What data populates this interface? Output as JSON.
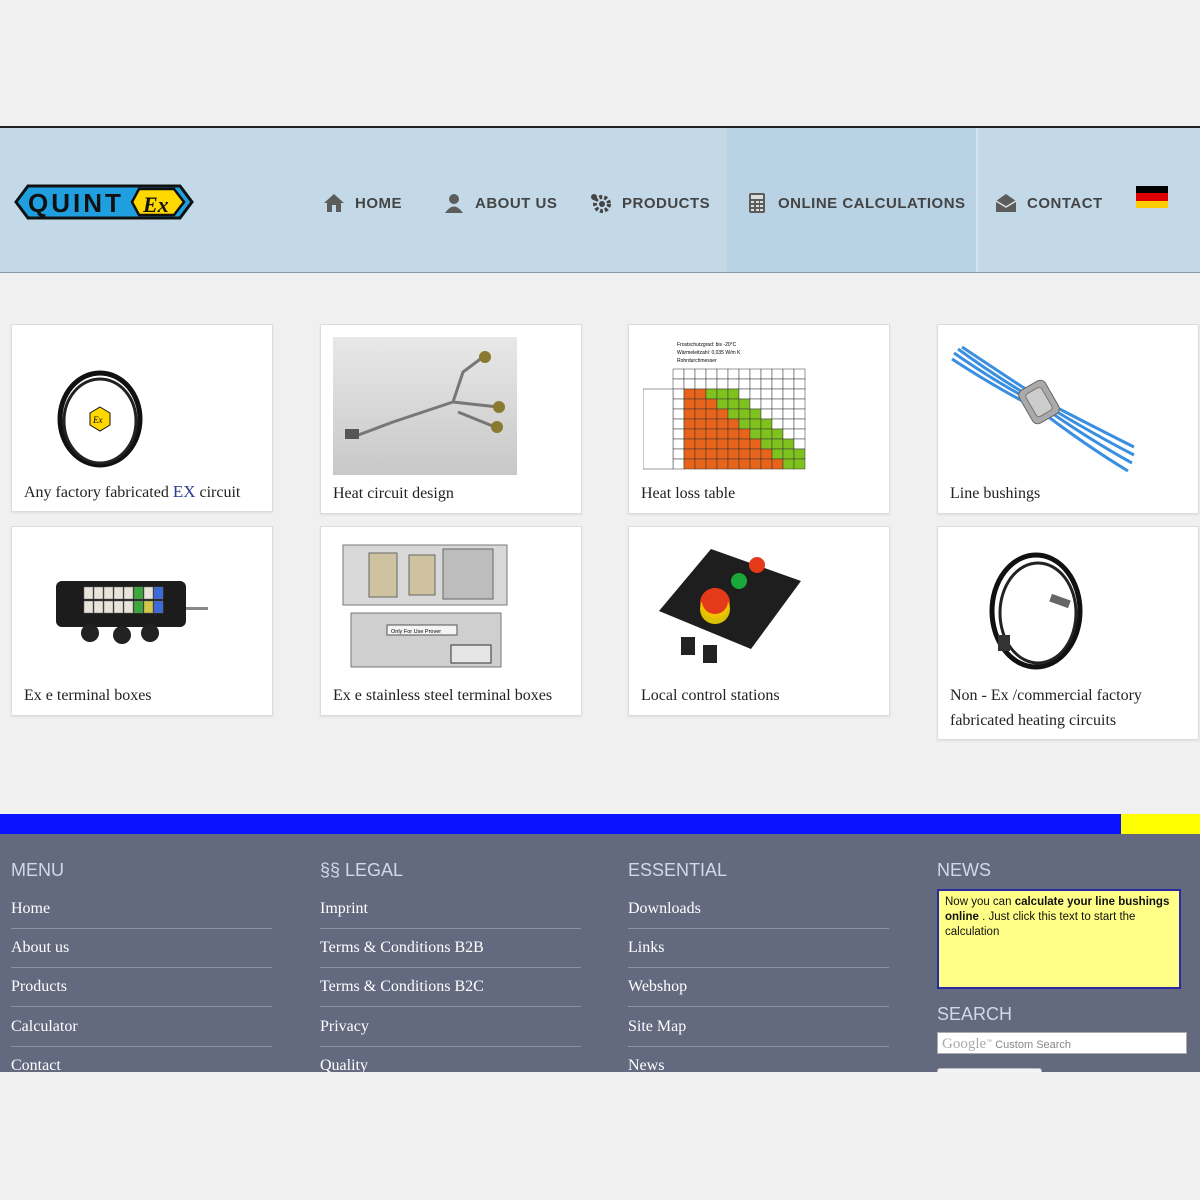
{
  "header": {
    "logo_text_1": "QUINT",
    "logo_text_2": "Ex",
    "nav": [
      {
        "label": "HOME",
        "icon": "house-icon"
      },
      {
        "label": "ABOUT US",
        "icon": "person-icon"
      },
      {
        "label": "PRODUCTS",
        "icon": "gears-icon"
      },
      {
        "label": "ONLINE CALCULATIONS",
        "icon": "calculator-icon"
      },
      {
        "label": "CONTACT",
        "icon": "envelope-icon"
      }
    ],
    "language_flag": "german-flag-icon"
  },
  "products": [
    {
      "caption_pre": "Any factory fabricated ",
      "caption_em": "EX",
      "caption_post": " circuit"
    },
    {
      "caption": "Heat circuit design"
    },
    {
      "caption": "Heat loss table"
    },
    {
      "caption": "Line bushings"
    },
    {
      "caption": "Ex e terminal boxes"
    },
    {
      "caption": "Ex e stainless steel terminal boxes"
    },
    {
      "caption": "Local control stations"
    },
    {
      "caption_line1": "Non - Ex /commercial factory",
      "caption_line2": "fabricated heating circuits"
    }
  ],
  "heat_loss_table": {
    "line1": "Frostschutzgrad: bis -20°C",
    "line2": "Wärmeleitzahl: 0,035 W/m K",
    "line3": "Rohrdurchmesser"
  },
  "terminal_box_label": "Only For Use Prover",
  "footer": {
    "menu": {
      "title": "MENU",
      "links": [
        "Home",
        "About us",
        "Products",
        "Calculator",
        "Contact"
      ]
    },
    "legal": {
      "title": "§§ LEGAL",
      "links": [
        "Imprint",
        "Terms & Conditions B2B",
        "Terms & Conditions B2C",
        "Privacy",
        "Quality"
      ]
    },
    "essential": {
      "title": "ESSENTIAL",
      "links": [
        "Downloads",
        "Links",
        "Webshop",
        "Site Map",
        "News"
      ]
    },
    "news": {
      "title": "NEWS",
      "text_pre": "Now you can ",
      "text_bold": "calculate your line bushings online",
      "text_post": " . Just click this text to start the calculation"
    },
    "search": {
      "title": "SEARCH",
      "google": "Google",
      "placeholder": "Custom Search"
    }
  },
  "colors": {
    "header_bg": "#c3d9e8",
    "footer_bg": "#636a80",
    "stripe_blue": "#0b12ff",
    "stripe_yellow": "#ffff00",
    "news_bg": "#ffff88"
  }
}
